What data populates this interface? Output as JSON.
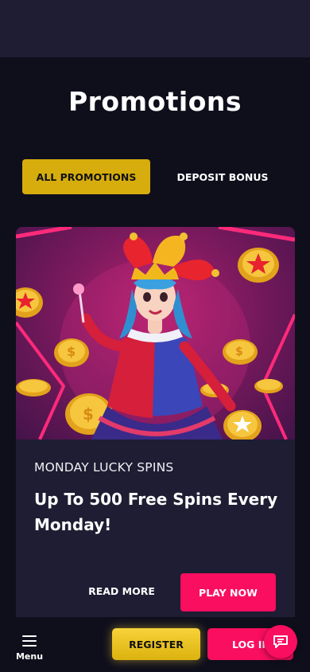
{
  "page": {
    "title": "Promotions"
  },
  "tabs": [
    {
      "label": "ALL PROMOTIONS",
      "active": true
    },
    {
      "label": "DEPOSIT BONUS",
      "active": false
    }
  ],
  "promotion": {
    "category": "MONDAY LUCKY SPINS",
    "title": "Up To 500 Free Spins Every Monday!",
    "read_more_label": "READ MORE",
    "play_now_label": "PLAY NOW",
    "image_icon": "jester-coins-illustration"
  },
  "bottom_nav": {
    "menu_label": "Menu",
    "register_label": "REGISTER",
    "login_label": "LOG IN",
    "chat_icon": "chat-icon"
  },
  "colors": {
    "background": "#0f0f1c",
    "surface": "#1e1d33",
    "accent_yellow": "#d6ad0d",
    "accent_pink": "#fa0e5f"
  }
}
